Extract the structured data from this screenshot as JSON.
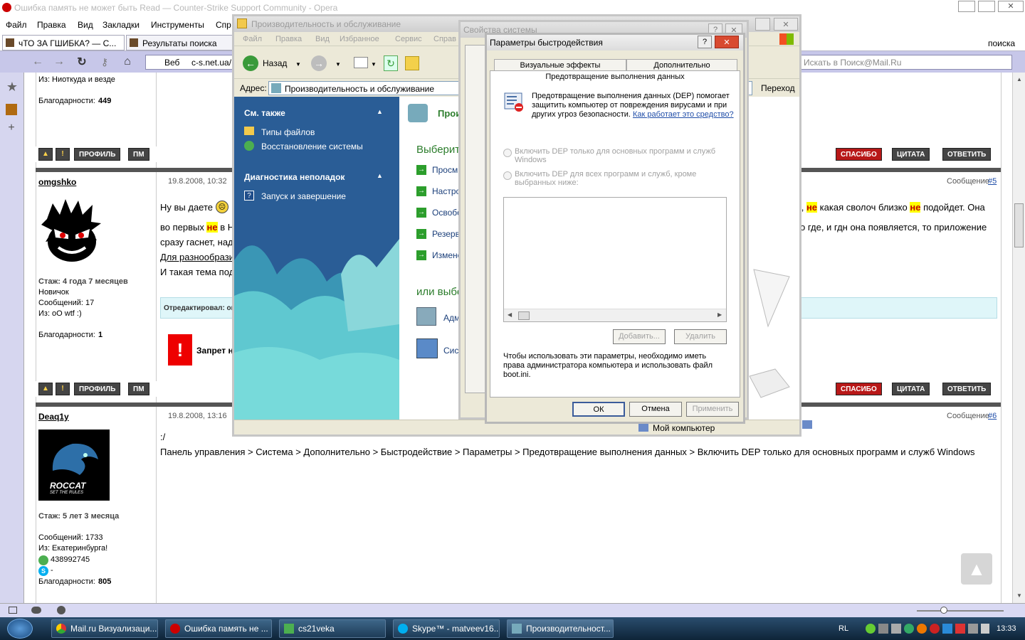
{
  "browser": {
    "title": "Ошибка память не может быть Read — Counter-Strike Support Community - Opera",
    "menu": [
      "Файл",
      "Правка",
      "Вид",
      "Закладки",
      "Инструменты",
      "Спр"
    ],
    "tabs": [
      "чТО ЗА ГШИБКА? — С...",
      "Результаты поиска"
    ],
    "tab_search_label": "поиска",
    "nav": {
      "web_label": "Веб",
      "url": "c-s.net.ua/",
      "search_placeholder": "Искать в Поиск@Mail.Ru"
    }
  },
  "forum": {
    "post0": {
      "from": "Из: Ниоткуда и везде",
      "thanks_label": "Благодарности:",
      "thanks": "449"
    },
    "buttons": {
      "profile": "ПРОФИЛЬ",
      "pm": "ПМ",
      "thanks": "СПАСИБО",
      "quote": "ЦИТАТА",
      "reply": "ОТВЕТИТЬ",
      "warn": "!"
    },
    "post5": {
      "user": "omgshko",
      "date": "19.8.2008, 10:32",
      "msg_label": "Сообщение",
      "msg_num": "#5",
      "stats": {
        "exp": "Стаж: 4 года 7 месяцев",
        "rank": "Новичок",
        "messages": "Сообщений: 17",
        "from": "Из: оО wtf :)",
        "thanks_label": "Благодарности:",
        "thanks": "1"
      },
      "line1_start": "Ну вы даете",
      "line1_end_a": "к,",
      "line1_hl1": "не",
      "line1_end_b": "какая сволоч близко",
      "line1_hl2": "не",
      "line1_end_c": "подойдет. Она",
      "line2_start": "во первых",
      "line2_hl": "не",
      "line2_b": "в Н",
      "line2_end": "о где, и гдн она появляется, то приложение",
      "line3": "сразу гаснет, над",
      "line4": "Для разнообрази",
      "line5": "И такая тема под",
      "edited": "Отредактировал: ог",
      "ban": "Запрет н"
    },
    "post6": {
      "user": "Deaq1y",
      "date": "19.8.2008, 13:16",
      "msg_label": "Сообщение",
      "msg_num": "#6",
      "avatar_text": "ROCCAT",
      "avatar_sub": "SET THE RULES",
      "stats": {
        "exp": "Стаж: 5 лет 3 месяца",
        "messages": "Сообщений: 1733",
        "from": "Из: Екатеринбурга!",
        "icq": "438992745",
        "skype": "-",
        "thanks_label": "Благодарности:",
        "thanks": "805"
      },
      "line1": ":/",
      "line2": "Панель управления > Система > Дополнительно > Быстродействие > Параметры > Предотвращение выполнения данных > Включить DEP только для основных программ и служб Windows"
    }
  },
  "explorer": {
    "title": "Производительность и обслуживание",
    "menu": [
      "Файл",
      "Правка",
      "Вид",
      "Избранное",
      "Сервис",
      "Справ"
    ],
    "back": "Назад",
    "address_label": "Адрес:",
    "address": "Производительность и обслуживание",
    "go": "Переход",
    "see_also": "См. также",
    "links1": [
      "Типы файлов",
      "Восстановление системы"
    ],
    "troubleshoot": "Диагностика неполадок",
    "links2": [
      "Запуск и завершение"
    ],
    "heading_a": "Прои",
    "choose_task": "Выберит",
    "tasks": [
      "Просм",
      "Настро",
      "Освобо",
      "Резерв",
      "Измене"
    ],
    "or_choose": "или выбе",
    "cpl": [
      "Адм",
      "Сист"
    ],
    "mycomputer": "Мой компьютер"
  },
  "sysprops": {
    "title": "Свойства системы"
  },
  "perf": {
    "title": "Параметры быстродействия",
    "tabs": [
      "Визуальные эффекты",
      "Дополнительно",
      "Предотвращение выполнения данных"
    ],
    "desc": "Предотвращение выполнения данных (DEP) помогает защитить компьютер от повреждения вирусами и при других угроз безопасности.",
    "link": "Как работает это средство?",
    "radio1": "Включить DEP только для основных программ и служб Windows",
    "radio2": "Включить DEP для всех программ и служб, кроме выбранных ниже:",
    "add": "Добавить...",
    "remove": "Удалить",
    "note": "Чтобы использовать эти параметры, необходимо иметь права администратора компьютера и использовать файл boot.ini.",
    "ok": "ОК",
    "cancel": "Отмена",
    "apply": "Применить"
  },
  "taskbar": {
    "items": [
      "Mail.ru Визуализаци...",
      "Ошибка память не ...",
      "cs21veka",
      "Skype™ - matveev16...",
      "Производительност..."
    ],
    "lang": "RL",
    "time": "13:33"
  }
}
